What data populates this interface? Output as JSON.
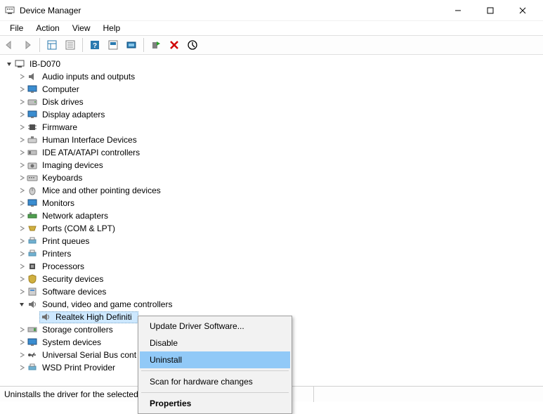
{
  "window": {
    "title": "Device Manager"
  },
  "menus": {
    "file": "File",
    "action": "Action",
    "view": "View",
    "help": "Help"
  },
  "tree": {
    "root": "IB-D070",
    "items": [
      "Audio inputs and outputs",
      "Computer",
      "Disk drives",
      "Display adapters",
      "Firmware",
      "Human Interface Devices",
      "IDE ATA/ATAPI controllers",
      "Imaging devices",
      "Keyboards",
      "Mice and other pointing devices",
      "Monitors",
      "Network adapters",
      "Ports (COM & LPT)",
      "Print queues",
      "Printers",
      "Processors",
      "Security devices",
      "Software devices",
      "Sound, video and game controllers",
      "Storage controllers",
      "System devices",
      "Universal Serial Bus cont",
      "WSD Print Provider"
    ],
    "selected_child": "Realtek High Definiti"
  },
  "context_menu": {
    "update": "Update Driver Software...",
    "disable": "Disable",
    "uninstall": "Uninstall",
    "scan": "Scan for hardware changes",
    "properties": "Properties"
  },
  "status": {
    "text": "Uninstalls the driver for the selected"
  }
}
